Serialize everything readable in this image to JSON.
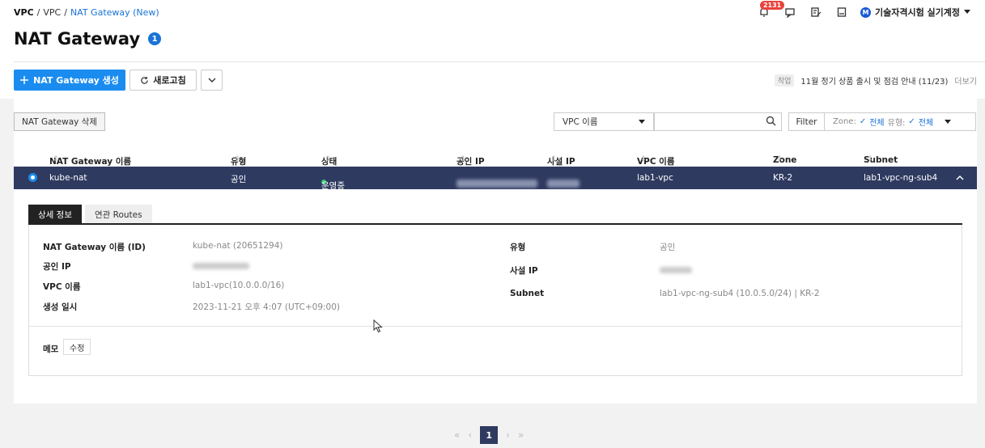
{
  "breadcrumb": {
    "root": "VPC",
    "sep1": "/",
    "item": "VPC",
    "sep2": "/",
    "current": "NAT Gateway (New)"
  },
  "header": {
    "title": "NAT Gateway",
    "info_count": "1"
  },
  "topbar": {
    "notification_count": "2131",
    "account_initial": "M",
    "account_name": "기술자격시험 실기계정",
    "icons": [
      "bell-icon",
      "edit-icon",
      "book-icon",
      "chevron-down-icon"
    ]
  },
  "toolbar": {
    "create_label": "NAT Gateway 생성",
    "refresh_label": "새로고침"
  },
  "notice": {
    "tag": "작업",
    "text": "11월 정기 상품 출시 및 점검 안내 (11/23)",
    "more": "더보기"
  },
  "actions": {
    "delete_label": "NAT Gateway 삭제"
  },
  "search": {
    "field_label": "VPC 이름",
    "value": "",
    "filter_label": "Filter",
    "zone_label": "Zone:",
    "zone_value": "전체",
    "type_label": "유형:",
    "type_value": "전체"
  },
  "table": {
    "columns": [
      "NAT Gateway 이름",
      "유형",
      "상태",
      "공인 IP",
      "사설 IP",
      "VPC 이름",
      "Zone",
      "Subnet"
    ],
    "rows": [
      {
        "name": "kube-nat",
        "type": "공인",
        "status": "운영중",
        "public_ip": "",
        "private_ip": "",
        "vpc": "lab1-vpc",
        "zone": "KR-2",
        "subnet": "lab1-vpc-ng-sub4"
      }
    ]
  },
  "detail": {
    "tabs": [
      "상세 정보",
      "연관 Routes"
    ],
    "left": [
      {
        "label": "NAT Gateway 이름 (ID)",
        "value": "kube-nat (20651294)"
      },
      {
        "label": "공인 IP",
        "value": ""
      },
      {
        "label": "VPC 이름",
        "value": "lab1-vpc(10.0.0.0/16)"
      },
      {
        "label": "생성 일시",
        "value": "2023-11-21 오후 4:07 (UTC+09:00)"
      }
    ],
    "right": [
      {
        "label": "유형",
        "value": "공인"
      },
      {
        "label": "사설 IP",
        "value": ""
      },
      {
        "label": "Subnet",
        "value": "lab1-vpc-ng-sub4 (10.0.5.0/24) | KR-2"
      }
    ],
    "memo_label": "메모",
    "memo_edit": "수정"
  },
  "pagination": {
    "current": "1"
  }
}
